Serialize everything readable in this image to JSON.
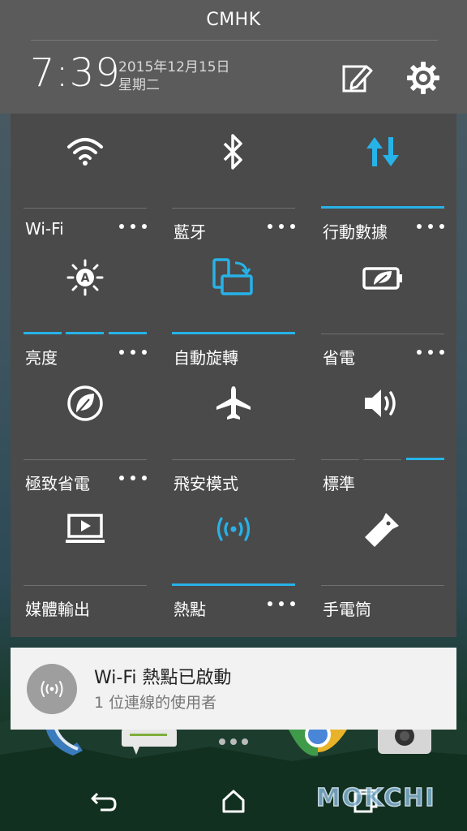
{
  "status": {
    "carrier": "CMHK",
    "time": "7:39",
    "date": "2015年12月15日",
    "weekday": "星期二"
  },
  "quick_settings": {
    "tiles": [
      {
        "label": "Wi-Fi",
        "icon": "wifi-icon",
        "active": false,
        "has_more": true
      },
      {
        "label": "藍牙",
        "icon": "bluetooth-icon",
        "active": false,
        "has_more": true
      },
      {
        "label": "行動數據",
        "icon": "mobile-data-icon",
        "active": true,
        "has_more": true
      },
      {
        "label": "亮度",
        "icon": "brightness-auto-icon",
        "level_segments_active": 3,
        "has_more": true
      },
      {
        "label": "自動旋轉",
        "icon": "auto-rotate-icon",
        "active": true,
        "has_more": false
      },
      {
        "label": "省電",
        "icon": "power-saver-icon",
        "active": false,
        "has_more": true
      },
      {
        "label": "極致省電",
        "icon": "extreme-power-saver-icon",
        "active": false,
        "has_more": true
      },
      {
        "label": "飛安模式",
        "icon": "airplane-icon",
        "active": false,
        "has_more": false
      },
      {
        "label": "標準",
        "icon": "volume-icon",
        "level_segments_active": 1,
        "has_more": false
      },
      {
        "label": "媒體輸出",
        "icon": "media-output-icon",
        "active": false,
        "has_more": false
      },
      {
        "label": "熱點",
        "icon": "hotspot-icon",
        "active": true,
        "has_more": true
      },
      {
        "label": "手電筒",
        "icon": "flashlight-icon",
        "active": false,
        "has_more": false
      }
    ]
  },
  "notification": {
    "title": "Wi-Fi 熱點已啟動",
    "subtitle": "1 位連線的使用者",
    "icon": "hotspot-icon"
  },
  "navbar": {
    "back": "back-icon",
    "home": "home-icon",
    "recents": "recents-icon"
  },
  "watermark": "MOKCHI",
  "colors": {
    "accent": "#27b2e8",
    "panel": "#4a4a4a",
    "header": "#5b5b5b"
  }
}
